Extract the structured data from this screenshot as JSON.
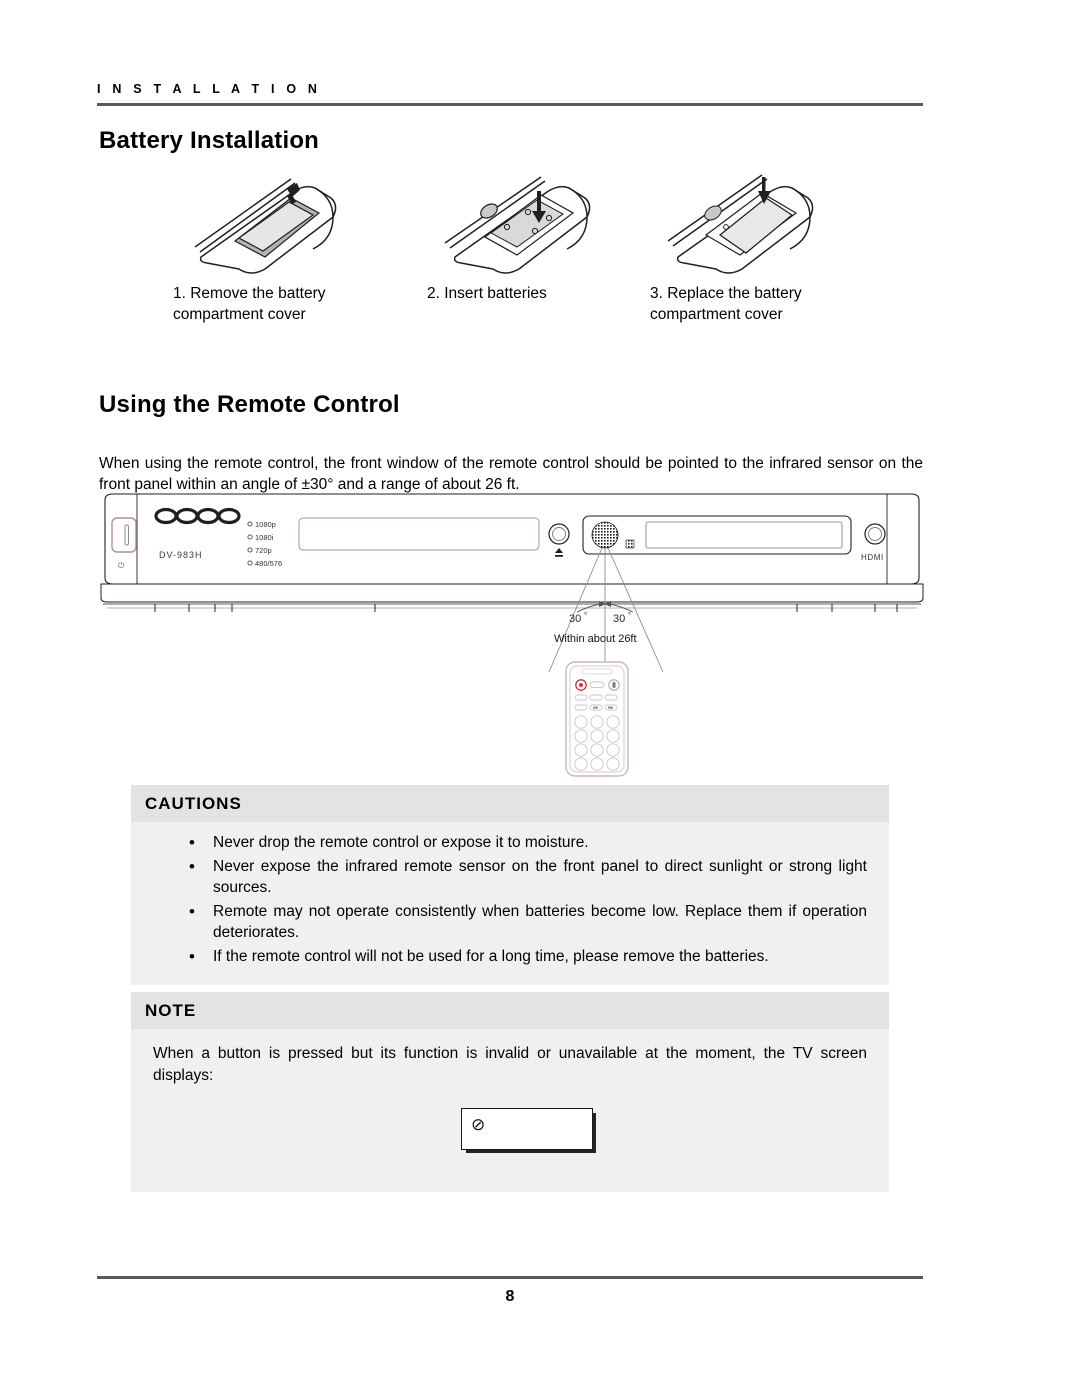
{
  "document": {
    "running_header": "I N S T A L L A T I O N",
    "page_number": "8"
  },
  "battery_section": {
    "title": "Battery Installation",
    "steps": [
      {
        "caption": "1.  Remove the battery compartment cover",
        "art": "remote-battery-cover-removal"
      },
      {
        "caption": "2. Insert batteries",
        "art": "remote-battery-insert"
      },
      {
        "caption": "3. Replace the battery compartment cover",
        "art": "remote-battery-cover-replace"
      }
    ]
  },
  "remote_section": {
    "title": "Using the Remote Control",
    "paragraph": "When using the remote control, the front window of the remote control should be pointed to the infrared sensor on the front panel within an angle of ±30° and a range of about 26 ft."
  },
  "front_panel": {
    "brand": "oppo",
    "model": "DV-983H",
    "power_symbol": "⏻",
    "resolution_leds": [
      "1080p",
      "1080i",
      "720p",
      "480/576"
    ],
    "buttons": [
      {
        "name": "eject",
        "label": "▲"
      },
      {
        "name": "hdmi",
        "label": "HDMI"
      },
      {
        "name": "stop",
        "label": "■"
      },
      {
        "name": "play-pause",
        "label": "▶/‖"
      }
    ],
    "ir_sensor_label": "ir-sensor",
    "angle_left": "30",
    "angle_right": "30",
    "degree_symbol": "°",
    "range_label": "Within about 26ft"
  },
  "cautions": {
    "title": "CAUTIONS",
    "bullet": "•",
    "items": [
      "Never drop the remote control or expose it to moisture.",
      "Never expose the infrared remote sensor on the front panel to direct sunlight or strong light sources.",
      "Remote may not operate consistently when batteries become low.  Replace them if operation deteriorates.",
      "If the remote control will not be used for a long time, please remove the batteries."
    ]
  },
  "note": {
    "title": "NOTE",
    "text": "When a button is pressed but its function is invalid or unavailable at the moment, the TV screen displays:",
    "screen_symbol": "⊘"
  },
  "colors": {
    "rule": "#5a5a5a",
    "callout_head_bg": "#e3e3e3",
    "callout_body_bg": "#f0f0f0",
    "power_accent": "#b08f96",
    "line_art": "#231f20"
  }
}
